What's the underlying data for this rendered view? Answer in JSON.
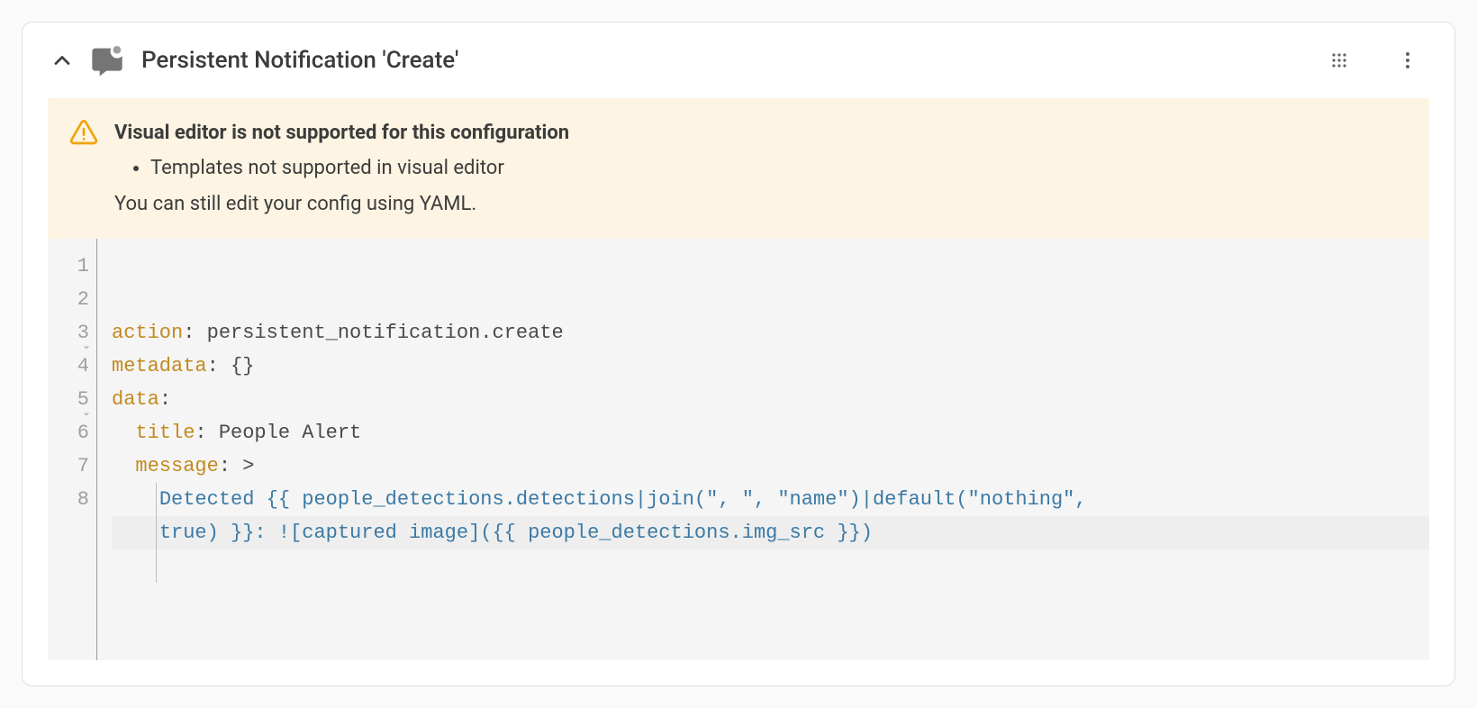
{
  "card": {
    "title": "Persistent Notification 'Create'"
  },
  "warning": {
    "title": "Visual editor is not supported for this configuration",
    "items": [
      "Templates not supported in visual editor"
    ],
    "footer": "You can still edit your config using YAML."
  },
  "editor": {
    "line_numbers": [
      "1",
      "2",
      "3",
      "4",
      "5",
      "6",
      "7",
      "8"
    ],
    "foldable_lines": [
      3,
      5
    ],
    "lines": [
      {
        "n": 1,
        "hl": false,
        "seg": [
          {
            "cls": "tok-key",
            "t": "action"
          },
          {
            "cls": "tok-punct",
            "t": ": "
          },
          {
            "cls": "tok-text",
            "t": "persistent_notification.create"
          }
        ]
      },
      {
        "n": 2,
        "hl": false,
        "seg": [
          {
            "cls": "tok-key",
            "t": "metadata"
          },
          {
            "cls": "tok-punct",
            "t": ": "
          },
          {
            "cls": "tok-text",
            "t": "{}"
          }
        ]
      },
      {
        "n": 3,
        "hl": false,
        "seg": [
          {
            "cls": "tok-key",
            "t": "data"
          },
          {
            "cls": "tok-punct",
            "t": ":"
          }
        ]
      },
      {
        "n": 4,
        "hl": false,
        "seg": [
          {
            "cls": "tok-text",
            "t": "  "
          },
          {
            "cls": "tok-key",
            "t": "title"
          },
          {
            "cls": "tok-punct",
            "t": ": "
          },
          {
            "cls": "tok-text",
            "t": "People Alert"
          }
        ]
      },
      {
        "n": 5,
        "hl": false,
        "seg": [
          {
            "cls": "tok-text",
            "t": "  "
          },
          {
            "cls": "tok-key",
            "t": "message"
          },
          {
            "cls": "tok-punct",
            "t": ": "
          },
          {
            "cls": "tok-text",
            "t": ">"
          }
        ]
      },
      {
        "n": 6,
        "hl": false,
        "seg": [
          {
            "cls": "tok-text",
            "t": "    "
          },
          {
            "cls": "tok-tmpl",
            "t": "Detected {{ people_detections.detections|join(\", \", \"name\")|default(\"nothing\","
          }
        ]
      },
      {
        "n": 7,
        "hl": true,
        "seg": [
          {
            "cls": "tok-text",
            "t": "    "
          },
          {
            "cls": "tok-tmpl",
            "t": "true) }}: ![captured image]({{ people_detections.img_src }})"
          }
        ]
      },
      {
        "n": 8,
        "hl": false,
        "seg": []
      }
    ]
  }
}
